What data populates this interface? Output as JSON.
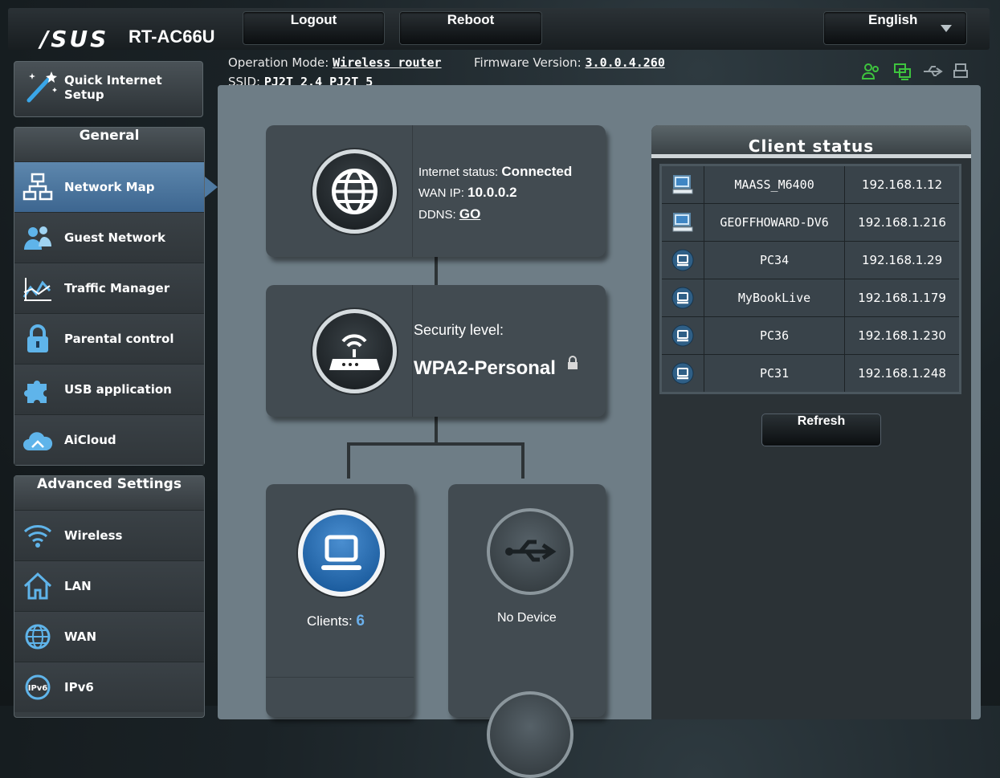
{
  "header": {
    "brand": "/SUS",
    "model": "RT-AC66U",
    "logout_label": "Logout",
    "reboot_label": "Reboot",
    "language": "English"
  },
  "info": {
    "operation_mode_label": "Operation Mode:",
    "operation_mode": "Wireless router",
    "firmware_label": "Firmware Version:",
    "firmware_version": "3.0.0.4.260",
    "ssid_label": "SSID:",
    "ssid_values": "PJ2T_2.4  PJ2T_5"
  },
  "sidebar": {
    "quick_setup_label": "Quick Internet Setup",
    "general_header": "General",
    "general_items": [
      {
        "label": "Network Map",
        "icon": "network-map-icon",
        "active": true
      },
      {
        "label": "Guest Network",
        "icon": "guest-network-icon"
      },
      {
        "label": "Traffic Manager",
        "icon": "traffic-manager-icon"
      },
      {
        "label": "Parental control",
        "icon": "lock-icon"
      },
      {
        "label": "USB application",
        "icon": "puzzle-icon"
      },
      {
        "label": "AiCloud",
        "icon": "cloud-icon"
      }
    ],
    "advanced_header": "Advanced Settings",
    "advanced_items": [
      {
        "label": "Wireless",
        "icon": "wifi-icon"
      },
      {
        "label": "LAN",
        "icon": "home-icon"
      },
      {
        "label": "WAN",
        "icon": "globe-icon"
      },
      {
        "label": "IPv6",
        "icon": "ipv6-icon"
      }
    ]
  },
  "network_map": {
    "internet_status_label": "Internet status:",
    "internet_status": "Connected",
    "wan_ip_label": "WAN IP:",
    "wan_ip": "10.0.0.2",
    "ddns_label": "DDNS:",
    "ddns_link": "GO",
    "security_label": "Security level:",
    "security_value": "WPA2-Personal",
    "clients_label": "Clients:",
    "clients_count": "6",
    "usb_status": "No Device"
  },
  "client_status": {
    "title": "Client status",
    "clients": [
      {
        "name": "MAASS_M6400",
        "ip": "192.168.1.12",
        "icon": "computer-icon"
      },
      {
        "name": "GEOFFHOWARD-DV6",
        "ip": "192.168.1.216",
        "icon": "computer-icon"
      },
      {
        "name": "PC34",
        "ip": "192.168.1.29",
        "icon": "device-icon"
      },
      {
        "name": "MyBookLive",
        "ip": "192.168.1.179",
        "icon": "device-icon"
      },
      {
        "name": "PC36",
        "ip": "192.168.1.230",
        "icon": "device-icon"
      },
      {
        "name": "PC31",
        "ip": "192.168.1.248",
        "icon": "device-icon"
      }
    ],
    "refresh_label": "Refresh"
  },
  "colors": {
    "accent_blue": "#4a86c0",
    "status_green": "#3ec43e",
    "panel_bg": "#6e7d86"
  }
}
